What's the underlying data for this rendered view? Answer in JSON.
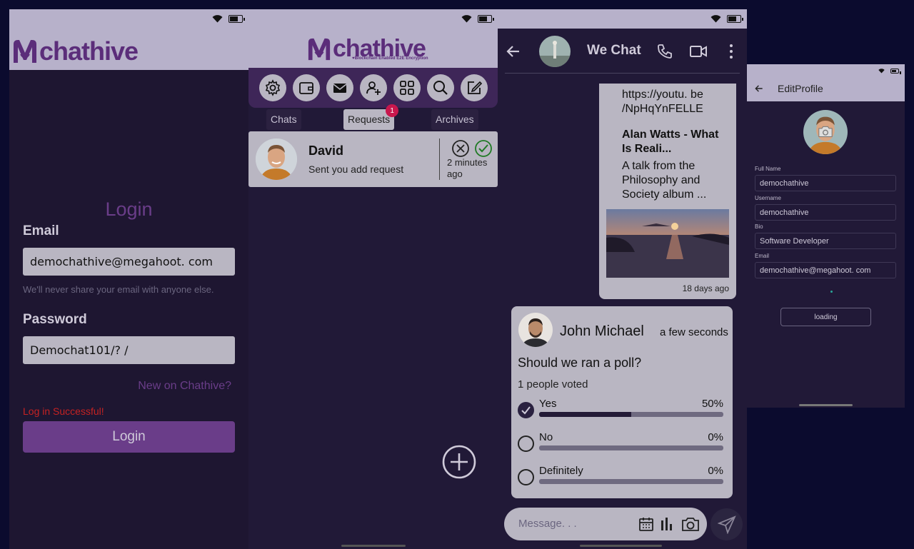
{
  "login_screen": {
    "logo": "chathive",
    "title": "Login",
    "email_label": "Email",
    "email_value": "demochathive@megahoot. com",
    "email_help": "We'll never share your email with anyone else.",
    "password_label": "Password",
    "password_value": "Demochat101/? /",
    "signup_link": "New on Chathive?",
    "status_message": "Log in Successful!",
    "login_button": "Login"
  },
  "requests_screen": {
    "logo": "chathive",
    "tagline": "♥Blockchain Enabled E2E Encryption",
    "toolbar_icons": [
      "gear-icon",
      "wallet-icon",
      "mail-icon",
      "add-friend-icon",
      "grid-icon",
      "search-icon",
      "compose-icon"
    ],
    "tabs": {
      "chats": "Chats",
      "requests": "Requests",
      "requests_badge": "1",
      "archives": "Archives"
    },
    "request": {
      "name": "David",
      "message": "Sent you add request",
      "time": "2 minutes ago"
    }
  },
  "chat_screen": {
    "title": "We Chat",
    "message1": {
      "link": "https://youtu. be /NpHqYnFELLE",
      "video_title": "Alan Watts - What Is Reali...",
      "description": "A talk from the Philosophy and Society album ...",
      "time": "18 days ago"
    },
    "poll": {
      "author": "John Michael",
      "time": "a few seconds",
      "question": "Should we ran a poll?",
      "votes": "1 people voted",
      "options": [
        {
          "label": "Yes",
          "percent": "50%",
          "fill": 0.5,
          "checked": true
        },
        {
          "label": "No",
          "percent": "0%",
          "fill": 0,
          "checked": false
        },
        {
          "label": "Definitely",
          "percent": "0%",
          "fill": 0,
          "checked": false
        }
      ]
    },
    "message_placeholder": "Message. . ."
  },
  "profile_screen": {
    "title": "EditProfile",
    "full_name_label": "Full Name",
    "full_name_value": "demochathive",
    "username_label": "Username",
    "username_value": "demochathive",
    "bio_label": "Bio",
    "bio_value": "Software Developer",
    "email_label": "Email",
    "email_value": "demochathive@megahoot. com",
    "button": "loading"
  },
  "colors": {
    "brand": "#5b2d7a",
    "background": "#211937",
    "surface": "#b9b6c2"
  }
}
